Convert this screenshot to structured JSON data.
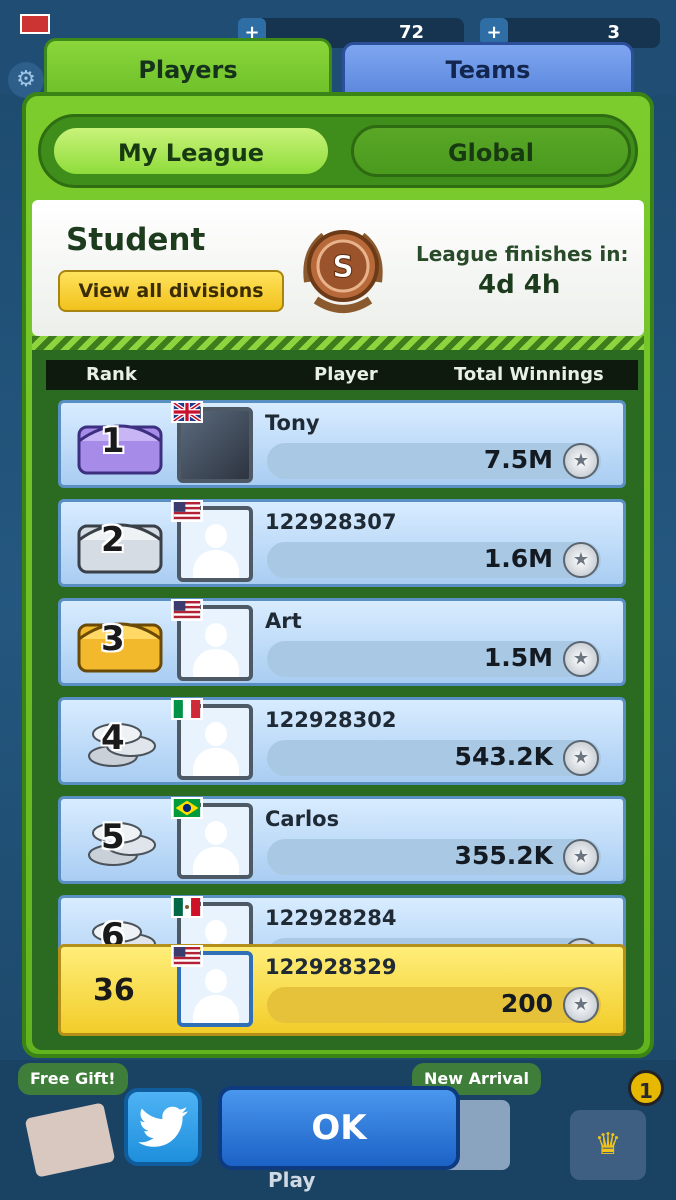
{
  "tabs": {
    "players": "Players",
    "teams": "Teams"
  },
  "segment": {
    "my_league": "My League",
    "global": "Global"
  },
  "league": {
    "name": "Student",
    "divisions_button": "View all divisions",
    "badge_letter": "S",
    "finish_label": "League finishes in:",
    "finish_value": "4d 4h"
  },
  "columns": {
    "rank": "Rank",
    "player": "Player",
    "winnings": "Total Winnings"
  },
  "rows": [
    {
      "rank": "1",
      "name": "Tony",
      "amount": "7.5M",
      "flag": "gb",
      "avatar": "photo",
      "icon": "purple-chest"
    },
    {
      "rank": "2",
      "name": "122928307",
      "amount": "1.6M",
      "flag": "us",
      "avatar": "default",
      "icon": "silver-chest"
    },
    {
      "rank": "3",
      "name": "Art",
      "amount": "1.5M",
      "flag": "us",
      "avatar": "default",
      "icon": "gold-chest"
    },
    {
      "rank": "4",
      "name": "122928302",
      "amount": "543.2K",
      "flag": "it",
      "avatar": "default",
      "icon": "coin-stack"
    },
    {
      "rank": "5",
      "name": "Carlos",
      "amount": "355.2K",
      "flag": "br",
      "avatar": "default",
      "icon": "coin-stack"
    },
    {
      "rank": "6",
      "name": "122928284",
      "amount": "",
      "flag": "mx",
      "avatar": "default",
      "icon": "coin-stack"
    }
  ],
  "me": {
    "rank": "36",
    "name": "122928329",
    "amount": "200",
    "flag": "us"
  },
  "buttons": {
    "ok": "OK"
  },
  "background": {
    "left_count": "72",
    "right_count": "3",
    "free_gift": "Free Gift!",
    "new_arrival": "New Arrival",
    "notification_count": "1",
    "play": "Play"
  },
  "colors": {
    "green": "#6bbd28",
    "blue": "#5b86dc",
    "yellow": "#f2cd2a",
    "row_blue": "#a9cdf2"
  }
}
